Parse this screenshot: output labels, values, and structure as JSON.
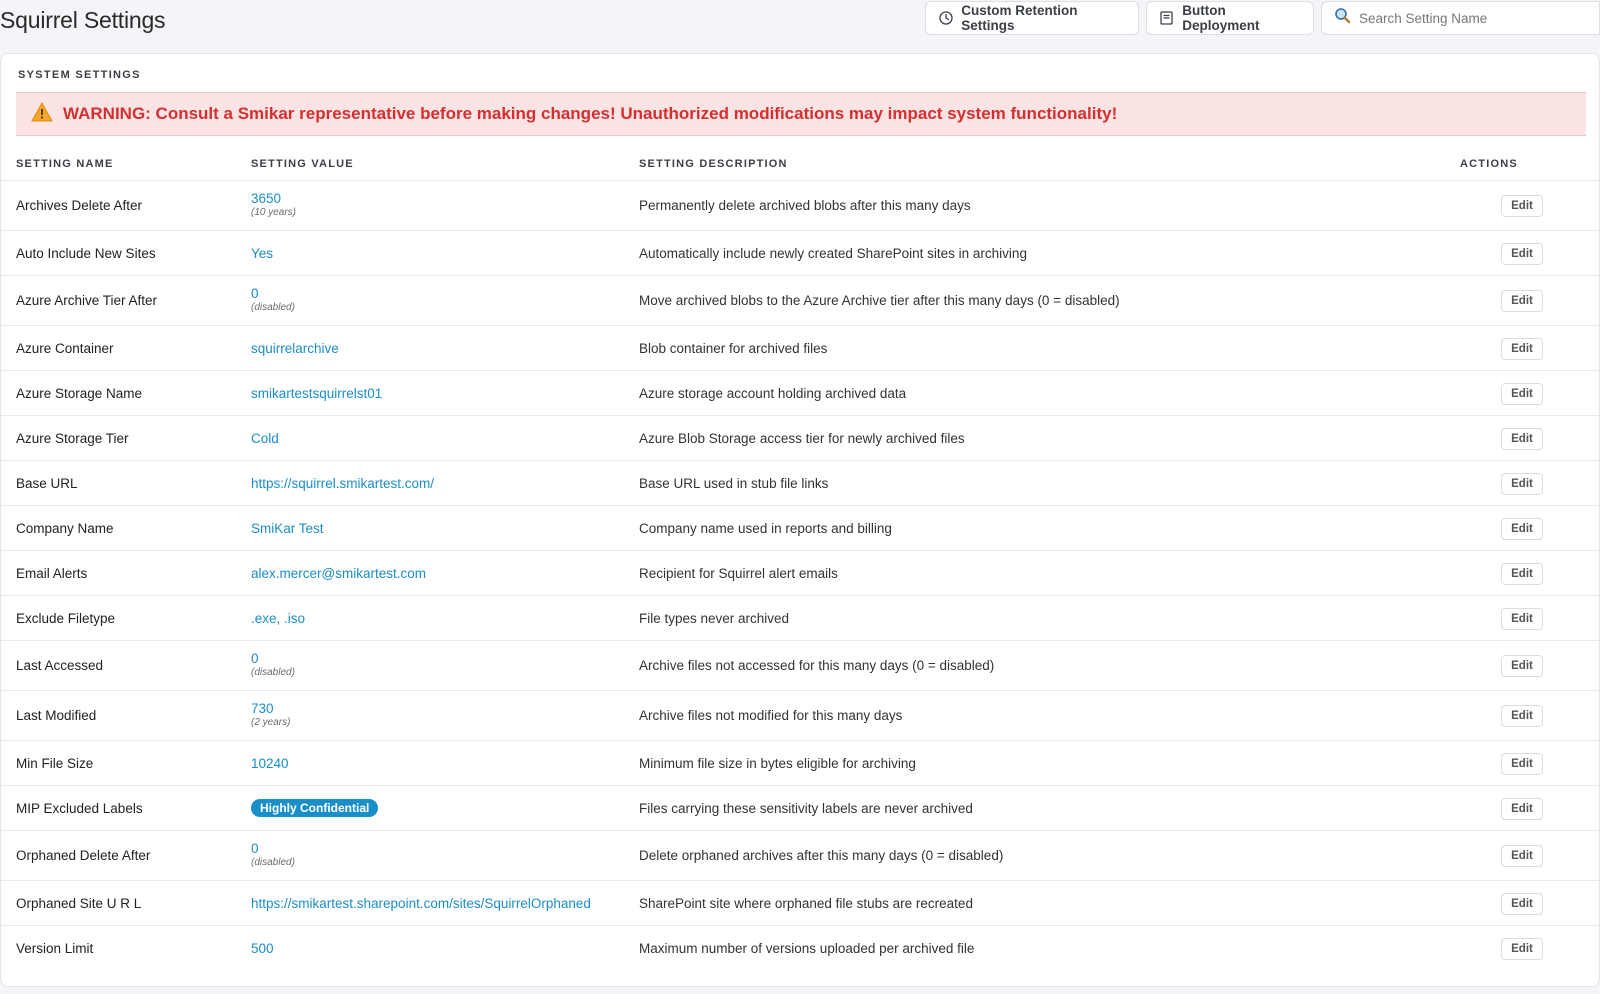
{
  "header": {
    "title": "Squirrel Settings",
    "retention_button": "Custom Retention Settings",
    "deployment_button": "Button Deployment",
    "search_placeholder": "Search Setting Name",
    "search_value": ""
  },
  "section": {
    "title": "SYSTEM SETTINGS",
    "warning": "WARNING: Consult a Smikar representative before making changes! Unauthorized modifications may impact system functionality!"
  },
  "table": {
    "columns": {
      "name": "SETTING NAME",
      "value": "SETTING VALUE",
      "description": "SETTING DESCRIPTION",
      "actions": "ACTIONS"
    },
    "edit_label": "Edit",
    "rows": [
      {
        "name": "Archives Delete After",
        "value": "3650",
        "note": "(10 years)",
        "description": "Permanently delete archived blobs after this many days"
      },
      {
        "name": "Auto Include New Sites",
        "value": "Yes",
        "note": "",
        "description": "Automatically include newly created SharePoint sites in archiving"
      },
      {
        "name": "Azure Archive Tier After",
        "value": "0",
        "note": "(disabled)",
        "description": "Move archived blobs to the Azure Archive tier after this many days (0 = disabled)"
      },
      {
        "name": "Azure Container",
        "value": "squirrelarchive",
        "note": "",
        "description": "Blob container for archived files"
      },
      {
        "name": "Azure Storage Name",
        "value": "smikartestsquirrelst01",
        "note": "",
        "description": "Azure storage account holding archived data"
      },
      {
        "name": "Azure Storage Tier",
        "value": "Cold",
        "note": "",
        "description": "Azure Blob Storage access tier for newly archived files"
      },
      {
        "name": "Base URL",
        "value": "https://squirrel.smikartest.com/",
        "note": "",
        "description": "Base URL used in stub file links"
      },
      {
        "name": "Company Name",
        "value": "SmiKar Test",
        "note": "",
        "description": "Company name used in reports and billing"
      },
      {
        "name": "Email Alerts",
        "value": "alex.mercer@smikartest.com",
        "note": "",
        "description": "Recipient for Squirrel alert emails"
      },
      {
        "name": "Exclude Filetype",
        "value": ".exe, .iso",
        "note": "",
        "description": "File types never archived"
      },
      {
        "name": "Last Accessed",
        "value": "0",
        "note": "(disabled)",
        "description": "Archive files not accessed for this many days (0 = disabled)"
      },
      {
        "name": "Last Modified",
        "value": "730",
        "note": "(2 years)",
        "description": "Archive files not modified for this many days"
      },
      {
        "name": "Min File Size",
        "value": "10240",
        "note": "",
        "description": "Minimum file size in bytes eligible for archiving"
      },
      {
        "name": "MIP Excluded Labels",
        "value": "Highly Confidential",
        "note": "",
        "badge": true,
        "description": "Files carrying these sensitivity labels are never archived"
      },
      {
        "name": "Orphaned Delete After",
        "value": "0",
        "note": "(disabled)",
        "description": "Delete orphaned archives after this many days (0 = disabled)"
      },
      {
        "name": "Orphaned Site U R L",
        "value": "https://smikartest.sharepoint.com/sites/SquirrelOrphaned",
        "note": "",
        "description": "SharePoint site where orphaned file stubs are recreated"
      },
      {
        "name": "Version Limit",
        "value": "500",
        "note": "",
        "description": "Maximum number of versions uploaded per archived file"
      }
    ]
  },
  "colors": {
    "accent": "#1a8ec9",
    "warning_bg": "#fde4e4",
    "warning_text": "#d62f2f"
  },
  "icons": {
    "retention": "clock-icon",
    "deployment": "document-icon",
    "search": "search-icon",
    "warning": "warning-icon"
  }
}
